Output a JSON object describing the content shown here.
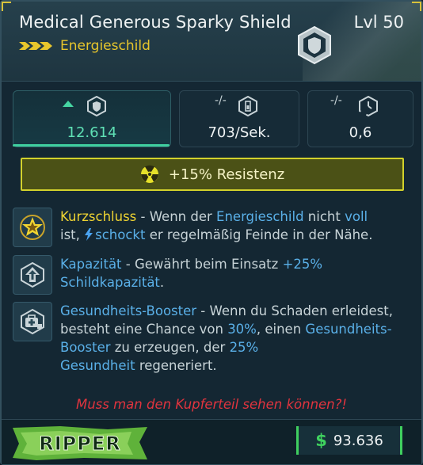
{
  "item": {
    "name": "Medical Generous Sparky Shield",
    "level": "Lvl 50",
    "type": "Energieschild",
    "rarity_color": "#e8c62c"
  },
  "stats": [
    {
      "value": "12.614",
      "compare": "",
      "icon": "shield-capacity-icon",
      "trend": "up"
    },
    {
      "compare": "-/-",
      "value": "703/Sek.",
      "icon": "recharge-rate-icon"
    },
    {
      "compare": "-/-",
      "value": "0,6",
      "icon": "recharge-delay-icon"
    }
  ],
  "element": {
    "text": "+15% Resistenz",
    "icon": "radiation-icon",
    "color": "#d2d12c"
  },
  "perks": [
    {
      "icon": "short-circuit-icon",
      "name": "Kurzschluss",
      "t1": " - Wenn der ",
      "h1": "Energieschild",
      "t2": " nicht ",
      "h2": "voll",
      "t3": "ist, ",
      "h3": "schockt",
      "t4": " er regelmäßig Feinde in der Nähe."
    },
    {
      "icon": "capacity-icon",
      "name": "Kapazität",
      "t1": " - Gewährt beim Einsatz ",
      "h1": "+25%",
      "h2": "Schildkapazität",
      "t2": "."
    },
    {
      "icon": "health-booster-icon",
      "name": "Gesundheits-Booster",
      "t1": " - Wenn du Schaden erleidest, besteht eine Chance von ",
      "h1": "30%",
      "t2": ", einen ",
      "h2": "Gesundheits-Booster",
      "t3": " zu erzeugen, der ",
      "h3": "25%",
      "h4": "Gesundheit",
      "t4": " regeneriert."
    }
  ],
  "flavor": "Muss man den Kupferteil sehen können?!",
  "manufacturer": {
    "logo_text": "RIPPER"
  },
  "price": {
    "currency": "$",
    "amount": "93.636"
  }
}
